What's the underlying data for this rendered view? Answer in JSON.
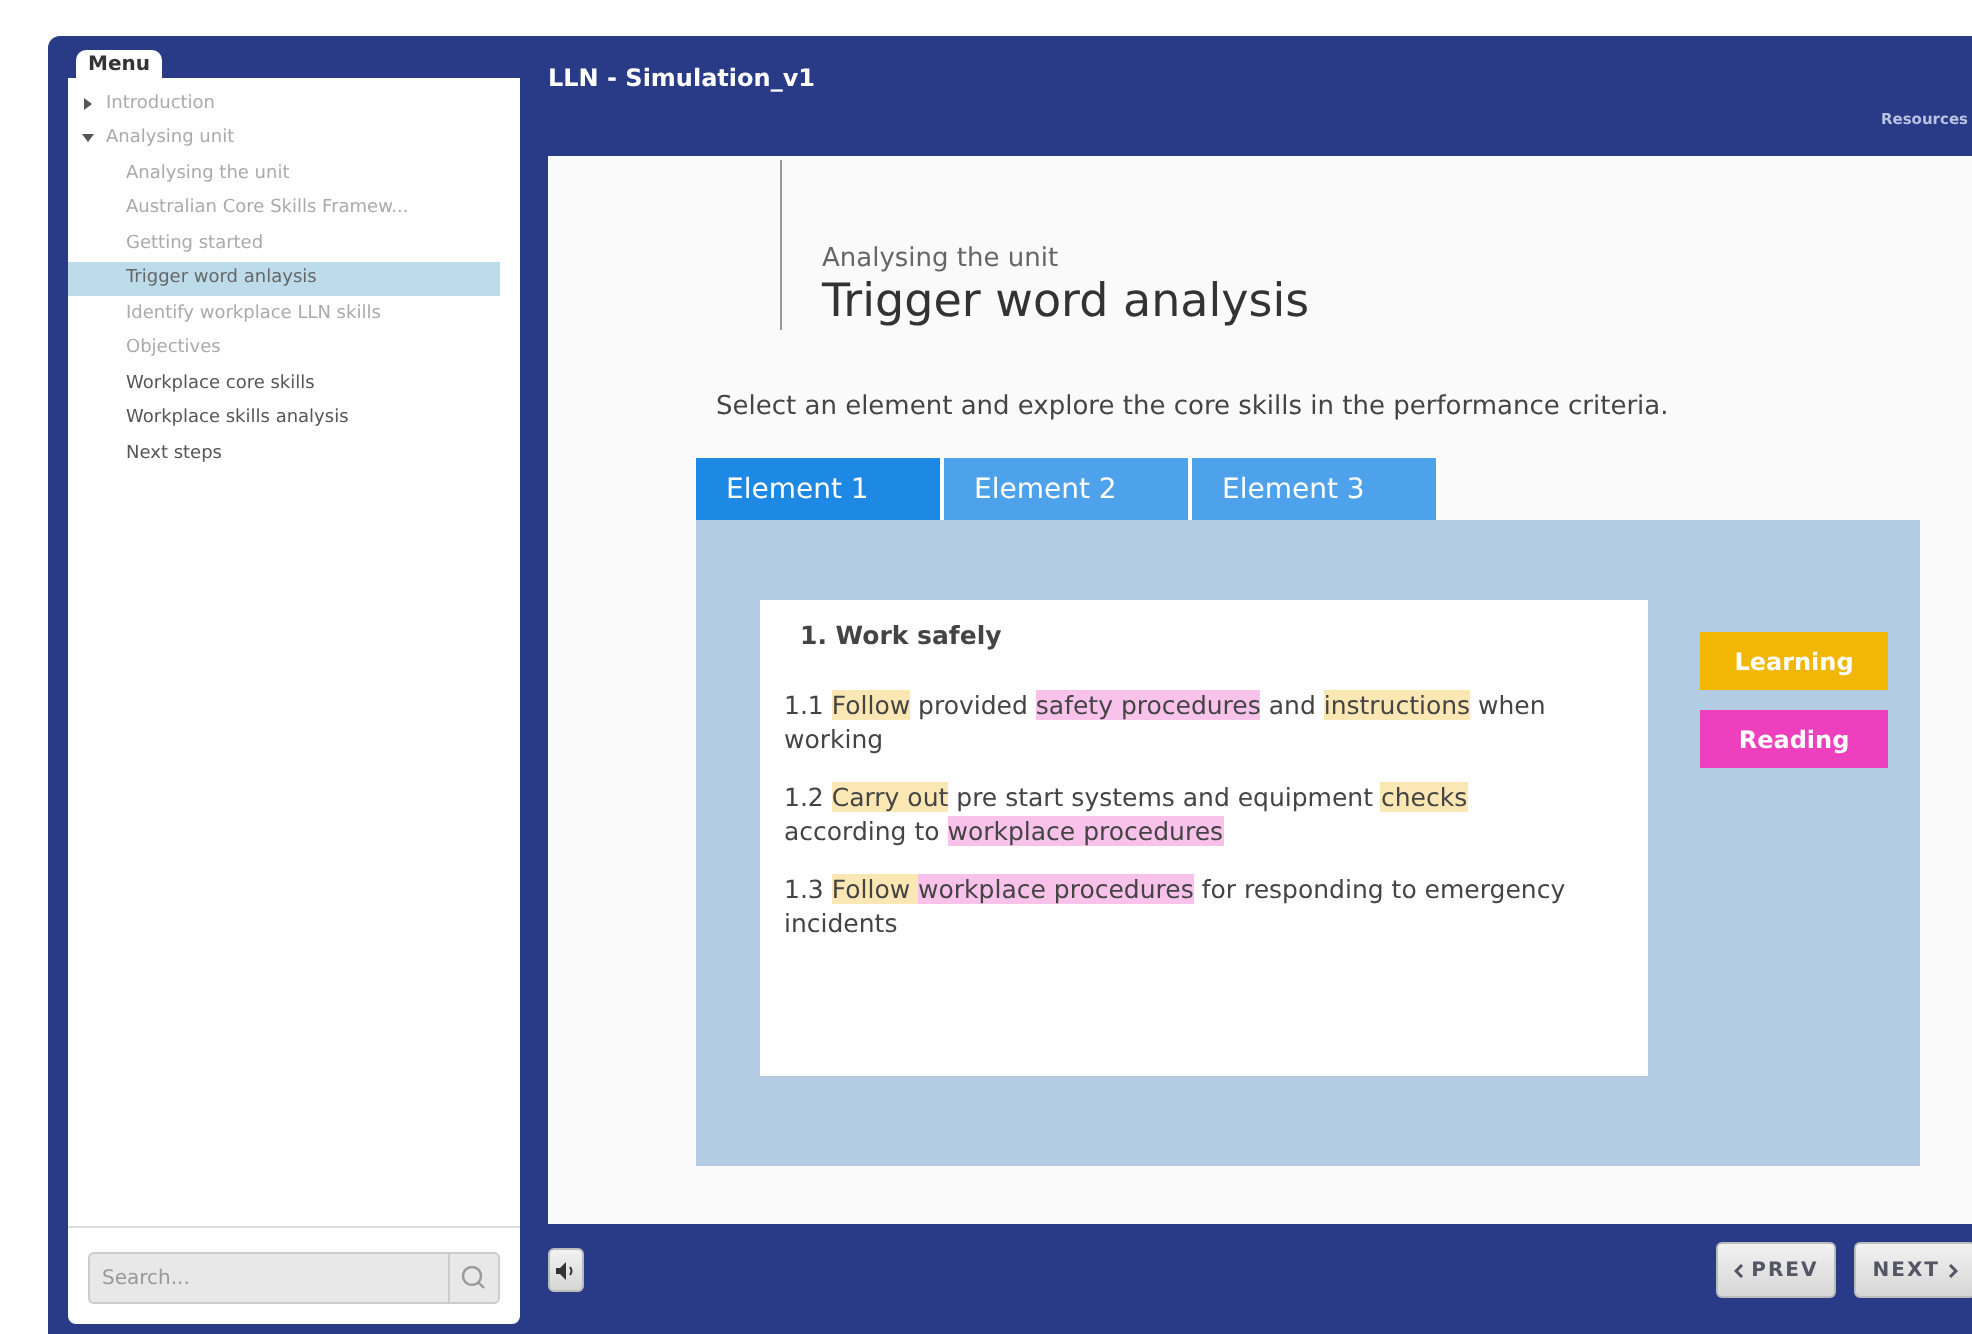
{
  "sidebar": {
    "menu_label": "Menu",
    "items": [
      {
        "label": "Introduction",
        "expanded": false,
        "selected": false,
        "visited": true
      },
      {
        "label": "Analysing unit",
        "expanded": true,
        "selected": false,
        "visited": true,
        "children": [
          {
            "label": "Analysing the unit",
            "selected": false,
            "visited": true
          },
          {
            "label": "Australian Core Skills Framew...",
            "selected": false,
            "visited": true
          },
          {
            "label": "Getting started",
            "selected": false,
            "visited": true
          },
          {
            "label": "Trigger word anlaysis",
            "selected": true,
            "visited": false
          },
          {
            "label": "Identify workplace LLN skills",
            "selected": false,
            "visited": true
          },
          {
            "label": "Objectives",
            "selected": false,
            "visited": true
          },
          {
            "label": "Workplace core skills",
            "selected": false,
            "visited": false
          },
          {
            "label": "Workplace skills analysis",
            "selected": false,
            "visited": false
          },
          {
            "label": "Next steps",
            "selected": false,
            "visited": false
          }
        ]
      }
    ],
    "search": {
      "placeholder": "Search..."
    }
  },
  "header": {
    "title": "LLN - Simulation_v1",
    "resources": "Resources"
  },
  "content": {
    "subtitle": "Analysing the unit",
    "title": "Trigger word analysis",
    "instructions": "Select an element and explore the core skills in the performance criteria.",
    "tabs": [
      {
        "label": "Element 1",
        "selected": true
      },
      {
        "label": "Element 2",
        "selected": false
      },
      {
        "label": "Element 3",
        "selected": false
      }
    ],
    "element_title": "1. Work safely",
    "criteria": [
      [
        {
          "text": "1.1 ",
          "kind": "plain"
        },
        {
          "text": "Follow",
          "kind": "learning"
        },
        {
          "text": " provided ",
          "kind": "plain"
        },
        {
          "text": "safety procedures",
          "kind": "reading"
        },
        {
          "text": " and ",
          "kind": "plain"
        },
        {
          "text": "instructions",
          "kind": "learning"
        },
        {
          "text": " when working",
          "kind": "plain"
        }
      ],
      [
        {
          "text": "1.2 ",
          "kind": "plain"
        },
        {
          "text": "Carry out",
          "kind": "learning"
        },
        {
          "text": " pre start systems and equipment ",
          "kind": "plain"
        },
        {
          "text": "checks",
          "kind": "learning"
        },
        {
          "text": " according to ",
          "kind": "plain"
        },
        {
          "text": "workplace procedures",
          "kind": "reading"
        }
      ],
      [
        {
          "text": "1.3 ",
          "kind": "plain"
        },
        {
          "text": "Follow ",
          "kind": "learning"
        },
        {
          "text": "workplace procedures",
          "kind": "reading"
        },
        {
          "text": " for responding to emergency incidents",
          "kind": "plain"
        }
      ]
    ],
    "legend": [
      {
        "label": "Learning",
        "color": "#f2b705"
      },
      {
        "label": "Reading",
        "color": "#ee3fbf"
      }
    ]
  },
  "footer": {
    "prev": "PREV",
    "next": "NEXT"
  }
}
